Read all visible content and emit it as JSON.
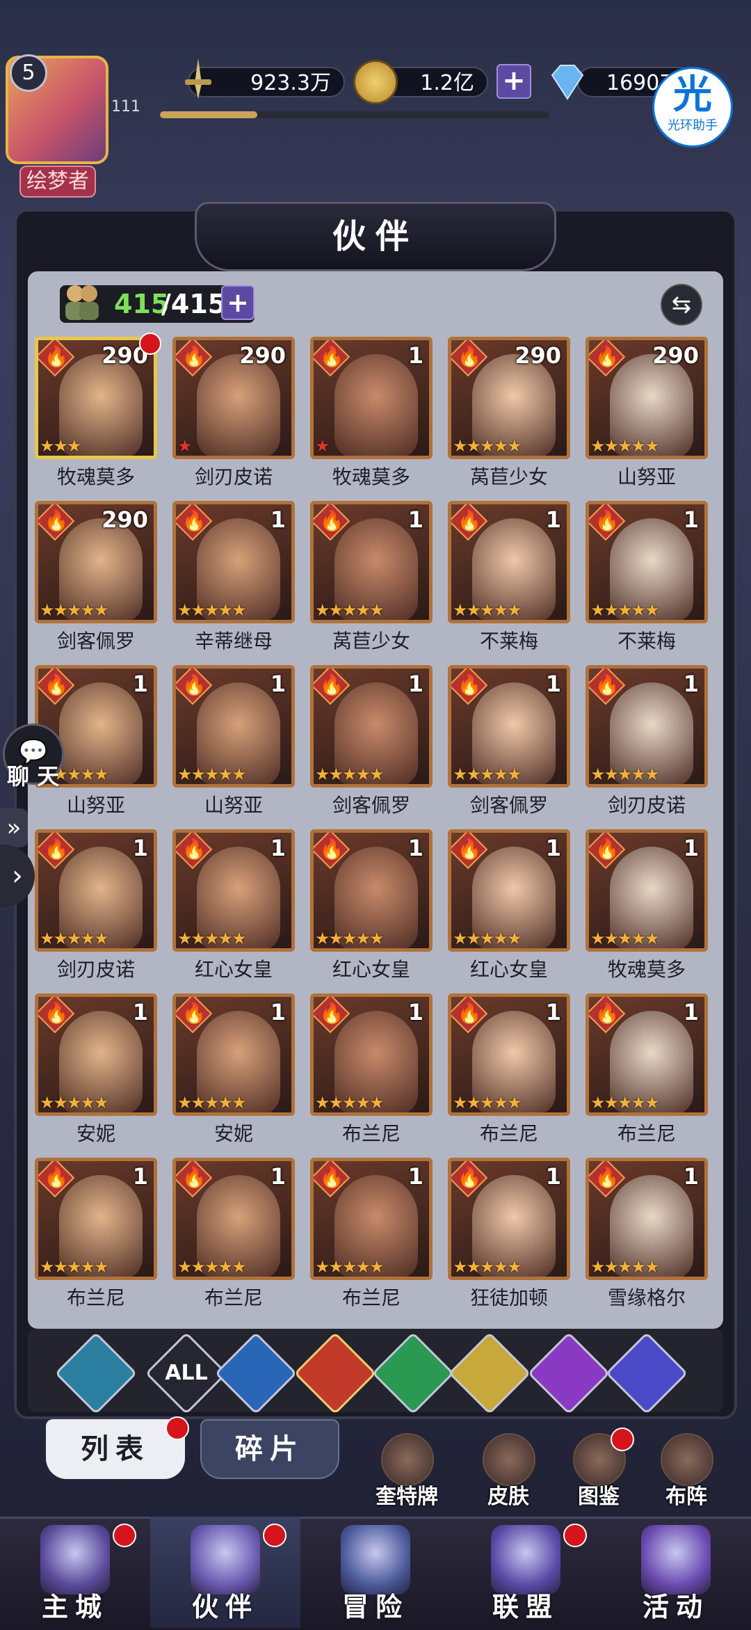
{
  "player": {
    "level": "5",
    "title": "绘梦者",
    "sub_number": "111"
  },
  "resources": {
    "power": "923.3万",
    "gold": "1.2亿",
    "gems": "16907",
    "add_symbol": "+"
  },
  "helper": {
    "glyph": "光",
    "label": "光环助手"
  },
  "panel": {
    "title": "伙伴",
    "count_current": "415",
    "count_total": "/415",
    "add_symbol": "+",
    "swap_glyph": "⇆"
  },
  "heroes": [
    {
      "name": "牧魂莫多",
      "level": "290",
      "stars": 3,
      "star_type": "gold",
      "dot": true,
      "frame": "gold"
    },
    {
      "name": "剑刃皮诺",
      "level": "290",
      "stars": 1,
      "star_type": "red",
      "dot": false,
      "frame": "bronze"
    },
    {
      "name": "牧魂莫多",
      "level": "1",
      "stars": 1,
      "star_type": "red",
      "dot": false,
      "frame": "bronze"
    },
    {
      "name": "莴苣少女",
      "level": "290",
      "stars": 5,
      "star_type": "gold",
      "dot": false,
      "frame": "bronze"
    },
    {
      "name": "山努亚",
      "level": "290",
      "stars": 5,
      "star_type": "gold",
      "dot": false,
      "frame": "bronze"
    },
    {
      "name": "剑客佩罗",
      "level": "290",
      "stars": 5,
      "star_type": "gold",
      "dot": false,
      "frame": "bronze"
    },
    {
      "name": "辛蒂继母",
      "level": "1",
      "stars": 5,
      "star_type": "gold",
      "dot": false,
      "frame": "bronze"
    },
    {
      "name": "莴苣少女",
      "level": "1",
      "stars": 5,
      "star_type": "gold",
      "dot": false,
      "frame": "bronze"
    },
    {
      "name": "不莱梅",
      "level": "1",
      "stars": 5,
      "star_type": "gold",
      "dot": false,
      "frame": "bronze"
    },
    {
      "name": "不莱梅",
      "level": "1",
      "stars": 5,
      "star_type": "gold",
      "dot": false,
      "frame": "bronze"
    },
    {
      "name": "山努亚",
      "level": "1",
      "stars": 5,
      "star_type": "gold",
      "dot": false,
      "frame": "bronze"
    },
    {
      "name": "山努亚",
      "level": "1",
      "stars": 5,
      "star_type": "gold",
      "dot": false,
      "frame": "bronze"
    },
    {
      "name": "剑客佩罗",
      "level": "1",
      "stars": 5,
      "star_type": "gold",
      "dot": false,
      "frame": "bronze"
    },
    {
      "name": "剑客佩罗",
      "level": "1",
      "stars": 5,
      "star_type": "gold",
      "dot": false,
      "frame": "bronze"
    },
    {
      "name": "剑刃皮诺",
      "level": "1",
      "stars": 5,
      "star_type": "gold",
      "dot": false,
      "frame": "bronze"
    },
    {
      "name": "剑刃皮诺",
      "level": "1",
      "stars": 5,
      "star_type": "gold",
      "dot": false,
      "frame": "bronze"
    },
    {
      "name": "红心女皇",
      "level": "1",
      "stars": 5,
      "star_type": "gold",
      "dot": false,
      "frame": "bronze"
    },
    {
      "name": "红心女皇",
      "level": "1",
      "stars": 5,
      "star_type": "gold",
      "dot": false,
      "frame": "bronze"
    },
    {
      "name": "红心女皇",
      "level": "1",
      "stars": 5,
      "star_type": "gold",
      "dot": false,
      "frame": "bronze"
    },
    {
      "name": "牧魂莫多",
      "level": "1",
      "stars": 5,
      "star_type": "gold",
      "dot": false,
      "frame": "bronze"
    },
    {
      "name": "安妮",
      "level": "1",
      "stars": 5,
      "star_type": "gold",
      "dot": false,
      "frame": "bronze"
    },
    {
      "name": "安妮",
      "level": "1",
      "stars": 5,
      "star_type": "gold",
      "dot": false,
      "frame": "bronze"
    },
    {
      "name": "布兰尼",
      "level": "1",
      "stars": 5,
      "star_type": "gold",
      "dot": false,
      "frame": "bronze"
    },
    {
      "name": "布兰尼",
      "level": "1",
      "stars": 5,
      "star_type": "gold",
      "dot": false,
      "frame": "bronze"
    },
    {
      "name": "布兰尼",
      "level": "1",
      "stars": 5,
      "star_type": "gold",
      "dot": false,
      "frame": "bronze"
    },
    {
      "name": "布兰尼",
      "level": "1",
      "stars": 5,
      "star_type": "gold",
      "dot": false,
      "frame": "bronze"
    },
    {
      "name": "布兰尼",
      "level": "1",
      "stars": 5,
      "star_type": "gold",
      "dot": false,
      "frame": "bronze"
    },
    {
      "name": "布兰尼",
      "level": "1",
      "stars": 5,
      "star_type": "gold",
      "dot": false,
      "frame": "bronze"
    },
    {
      "name": "狂徒加顿",
      "level": "1",
      "stars": 5,
      "star_type": "gold",
      "dot": false,
      "frame": "bronze"
    },
    {
      "name": "雪缘格尔",
      "level": "1",
      "stars": 5,
      "star_type": "gold",
      "dot": false,
      "frame": "bronze"
    }
  ],
  "filters": [
    {
      "icon": "all-element-icon",
      "label": "",
      "color": "#2b7fa0"
    },
    {
      "icon": "all-text-icon",
      "label": "ALL",
      "color": "#262633"
    },
    {
      "icon": "water-element-icon",
      "label": "",
      "color": "#2a66b8"
    },
    {
      "icon": "fire-element-icon",
      "label": "",
      "color": "#c23a2a"
    },
    {
      "icon": "wind-element-icon",
      "label": "",
      "color": "#2a9a52"
    },
    {
      "icon": "light-element-icon",
      "label": "",
      "color": "#c8a83a"
    },
    {
      "icon": "dark-element-icon",
      "label": "",
      "color": "#8a3ac2"
    },
    {
      "icon": "cosmic-element-icon",
      "label": "",
      "color": "#4a4ac8"
    }
  ],
  "tabs": {
    "list": "列表",
    "fragments": "碎片"
  },
  "side_buttons": [
    {
      "label": "奎特牌",
      "dot": false
    },
    {
      "label": "皮肤",
      "dot": false
    },
    {
      "label": "图鉴",
      "dot": true
    },
    {
      "label": "布阵",
      "dot": false
    }
  ],
  "chat": {
    "label": "聊 天",
    "icon": "💬"
  },
  "nav": [
    {
      "label": "主城",
      "dot": true,
      "active": false,
      "color": "#5a4a9a"
    },
    {
      "label": "伙伴",
      "dot": true,
      "active": true,
      "color": "#6a5ab0"
    },
    {
      "label": "冒险",
      "dot": false,
      "active": false,
      "color": "#4a5a9a"
    },
    {
      "label": "联盟",
      "dot": true,
      "active": false,
      "color": "#5a4aa8"
    },
    {
      "label": "活动",
      "dot": false,
      "active": false,
      "color": "#6a4ab0"
    }
  ]
}
